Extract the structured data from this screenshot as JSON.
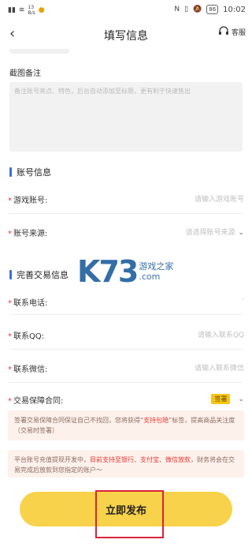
{
  "status_bar": {
    "left_speed": "13\nB/s",
    "battery": "86",
    "time": "10:02"
  },
  "nav": {
    "back_icon": "chevron-left",
    "title": "填写信息",
    "service_label": "客服"
  },
  "screenshot_remark": {
    "label": "截图备注",
    "placeholder": "备注账号亮点、特色，后台自动添加至标题，更有利于快速售出"
  },
  "account_section": {
    "title": "账号信息",
    "fields": [
      {
        "label": "游戏账号:",
        "placeholder": "请输入游戏账号"
      },
      {
        "label": "账号来源:",
        "placeholder": "请选择账号来源"
      }
    ]
  },
  "trade_section": {
    "title": "完善交易信息",
    "fields": [
      {
        "label": "联系电话:",
        "placeholder": "·"
      },
      {
        "label": "联系QQ:",
        "placeholder": "请输入联系QQ"
      },
      {
        "label": "联系微信:",
        "placeholder": "请输入联系微信"
      },
      {
        "label": "交易保障合同:",
        "tag": "签署"
      }
    ]
  },
  "notices": {
    "contract_pre": "签署交易保障合同保证自己不找回，您将获得“",
    "contract_red": "支持包赔",
    "contract_post": "”标签，提高商品关注度（交易时签署）",
    "withdraw_pre": "平台账号充值提现开发中，",
    "withdraw_red": "目前支持至银行、支付宝、微信放款",
    "withdraw_post": "，财务将会在交易完成后放款到您指定的账户～"
  },
  "watermark": {
    "logo": "K73",
    "line1": "游戏之家",
    "line2": ".com"
  },
  "footer": {
    "publish_label": "立即发布"
  },
  "colors": {
    "accent": "#f8d24a",
    "required": "#e53935",
    "section_bar": "#3a6fd8",
    "highlight": "#d9243a"
  }
}
